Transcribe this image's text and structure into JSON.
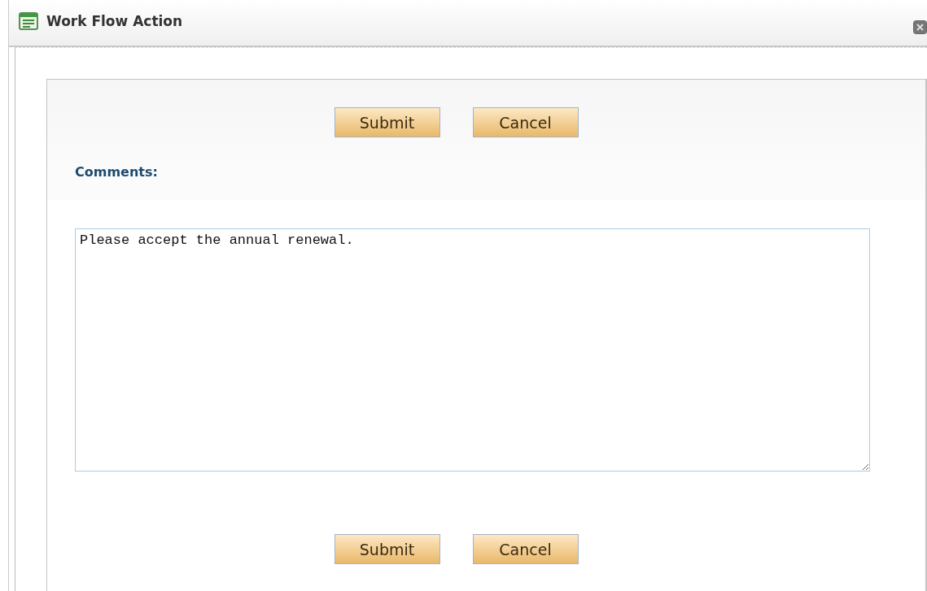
{
  "window": {
    "title": "Work Flow Action"
  },
  "top_buttons": [
    {
      "label": "Submit"
    },
    {
      "label": "Cancel"
    }
  ],
  "comments": {
    "label": "Comments:",
    "value": "Please accept the annual renewal."
  },
  "bottom_buttons": [
    {
      "label": "Submit"
    },
    {
      "label": "Cancel"
    }
  ]
}
